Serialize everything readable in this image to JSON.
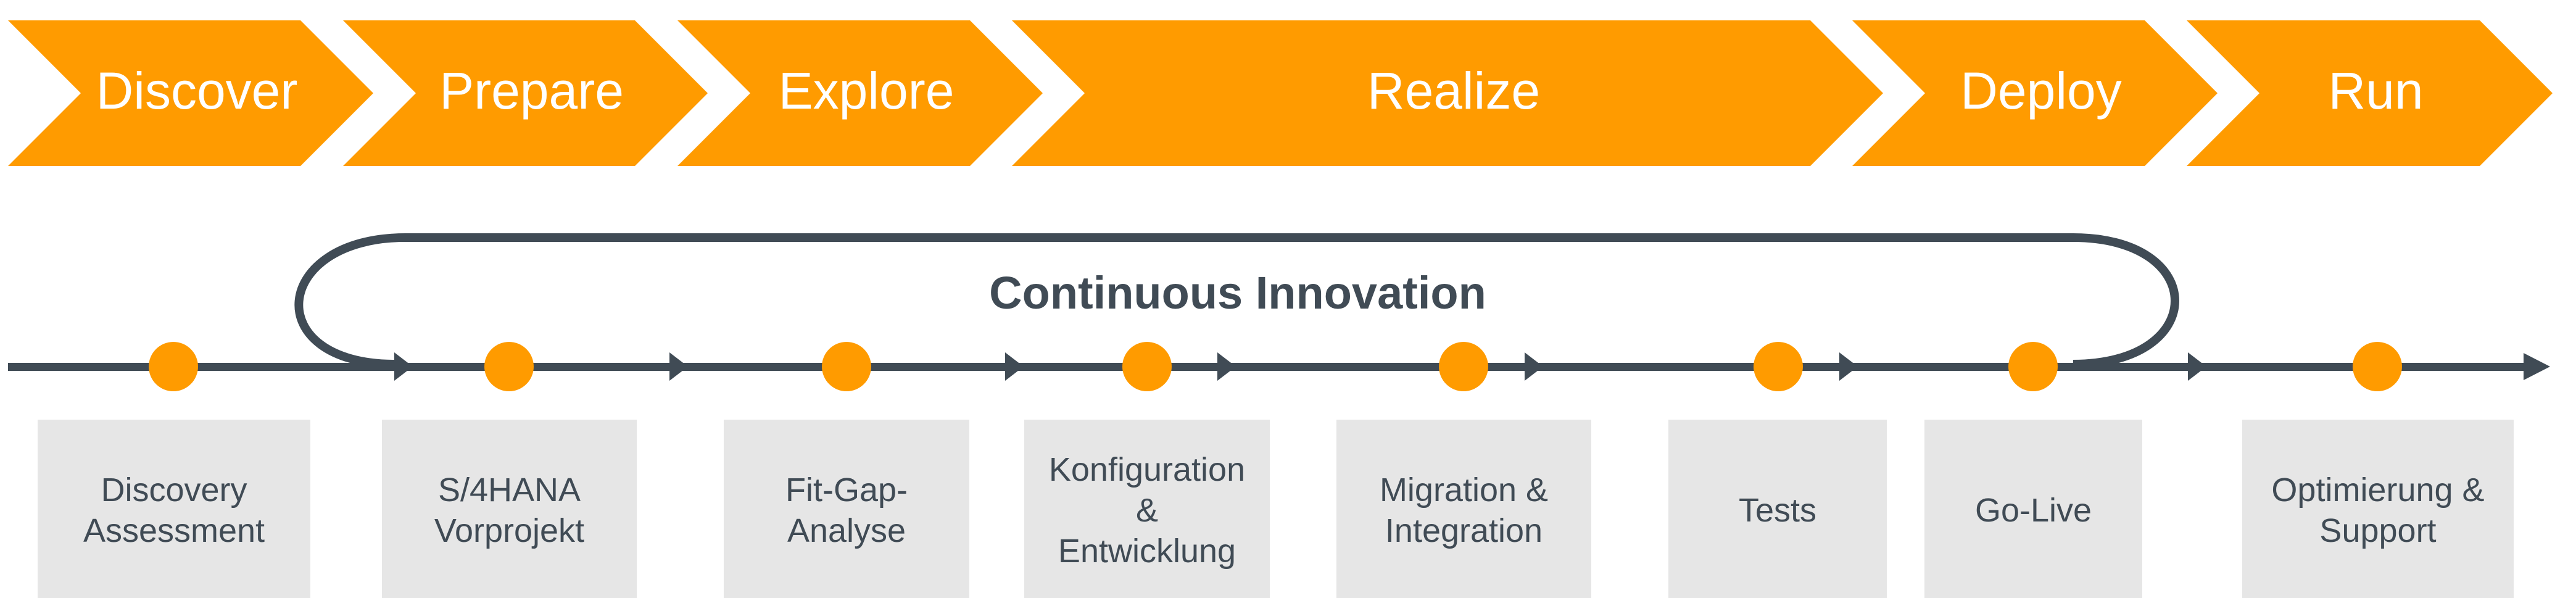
{
  "colors": {
    "phase_fill": "#FF9B00",
    "phase_text": "#FFFFFF",
    "line": "#404B55",
    "milestone_dot": "#FF9B00",
    "box_fill": "#E6E6E6",
    "box_text": "#404B55",
    "background": "#FFFFFF"
  },
  "phases": [
    {
      "label": "Discover"
    },
    {
      "label": "Prepare"
    },
    {
      "label": "Explore"
    },
    {
      "label": "Realize"
    },
    {
      "label": "Deploy"
    },
    {
      "label": "Run"
    }
  ],
  "loop": {
    "label": "Continuous Innovation"
  },
  "milestones": [
    {
      "lines": [
        "Discovery",
        "Assessment"
      ]
    },
    {
      "lines": [
        "S/4HANA",
        "Vorprojekt"
      ]
    },
    {
      "lines": [
        "Fit-Gap-",
        "Analyse"
      ]
    },
    {
      "lines": [
        "Konfiguration",
        "&",
        "Entwicklung"
      ]
    },
    {
      "lines": [
        "Migration &",
        "Integration"
      ]
    },
    {
      "lines": [
        "Tests"
      ]
    },
    {
      "lines": [
        "Go-Live"
      ]
    },
    {
      "lines": [
        "Optimierung &",
        "Support"
      ]
    }
  ]
}
